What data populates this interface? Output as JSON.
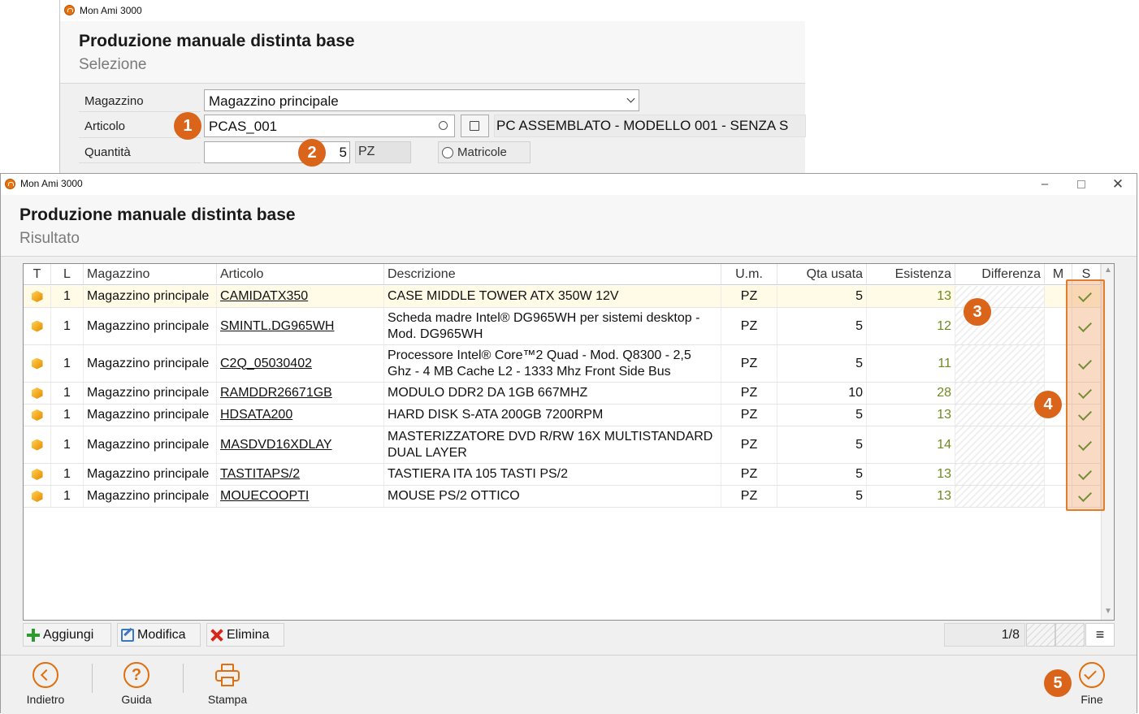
{
  "app_name": "Mon Ami 3000",
  "back_window": {
    "title": "Produzione manuale distinta base",
    "subtitle": "Selezione",
    "magazzino_label": "Magazzino",
    "magazzino_value": "Magazzino principale",
    "articolo_label": "Articolo",
    "articolo_value": "PCAS_001",
    "articolo_desc": "PC ASSEMBLATO - MODELLO 001 - SENZA S",
    "quantita_label": "Quantità",
    "quantita_value": "5",
    "um_value": "PZ",
    "matricole_label": "Matricole"
  },
  "front_window": {
    "title": "Produzione manuale distinta base",
    "subtitle": "Risultato"
  },
  "grid": {
    "headers": {
      "t": "T",
      "l": "L",
      "magazzino": "Magazzino",
      "articolo": "Articolo",
      "descrizione": "Descrizione",
      "um": "U.m.",
      "qta": "Qta usata",
      "esistenza": "Esistenza",
      "differenza": "Differenza",
      "m": "M",
      "s": "S"
    },
    "rows": [
      {
        "l": "1",
        "magazzino": "Magazzino principale",
        "articolo": "CAMIDATX350",
        "descrizione": "CASE MIDDLE TOWER ATX  350W 12V",
        "um": "PZ",
        "qta": "5",
        "esistenza": "13"
      },
      {
        "l": "1",
        "magazzino": "Magazzino principale",
        "articolo": "SMINTL.DG965WH",
        "descrizione": "Scheda madre Intel® DG965WH per sistemi desktop - Mod. DG965WH",
        "um": "PZ",
        "qta": "5",
        "esistenza": "12"
      },
      {
        "l": "1",
        "magazzino": "Magazzino principale",
        "articolo": "C2Q_05030402",
        "descrizione": "Processore Intel® Core™2 Quad - Mod. Q8300 - 2,5 Ghz - 4 MB Cache L2 - 1333 Mhz Front Side Bus",
        "um": "PZ",
        "qta": "5",
        "esistenza": "11"
      },
      {
        "l": "1",
        "magazzino": "Magazzino principale",
        "articolo": "RAMDDR26671GB",
        "descrizione": "MODULO DDR2 DA 1GB 667MHZ",
        "um": "PZ",
        "qta": "10",
        "esistenza": "28"
      },
      {
        "l": "1",
        "magazzino": "Magazzino principale",
        "articolo": "HDSATA200",
        "descrizione": "HARD DISK S-ATA 200GB 7200RPM",
        "um": "PZ",
        "qta": "5",
        "esistenza": "13"
      },
      {
        "l": "1",
        "magazzino": "Magazzino principale",
        "articolo": "MASDVD16XDLAY",
        "descrizione": "MASTERIZZATORE DVD R/RW 16X MULTISTANDARD DUAL LAYER",
        "um": "PZ",
        "qta": "5",
        "esistenza": "14"
      },
      {
        "l": "1",
        "magazzino": "Magazzino principale",
        "articolo": "TASTITAPS/2",
        "descrizione": "TASTIERA ITA 105 TASTI PS/2",
        "um": "PZ",
        "qta": "5",
        "esistenza": "13"
      },
      {
        "l": "1",
        "magazzino": "Magazzino principale",
        "articolo": "MOUECOOPTI",
        "descrizione": "MOUSE PS/2 OTTICO",
        "um": "PZ",
        "qta": "5",
        "esistenza": "13"
      }
    ]
  },
  "toolbar": {
    "aggiungi": "Aggiungi",
    "modifica": "Modifica",
    "elimina": "Elimina",
    "pager": "1/8",
    "menu_icon": "≡"
  },
  "footer": {
    "indietro": "Indietro",
    "guida": "Guida",
    "stampa": "Stampa",
    "fine": "Fine",
    "guida_icon": "?"
  },
  "callouts": [
    "1",
    "2",
    "3",
    "4",
    "5"
  ],
  "colors": {
    "accent": "#e0700f",
    "callout": "#d9641a",
    "check": "#3b8d2c",
    "esistenza": "#6d8a1e"
  }
}
